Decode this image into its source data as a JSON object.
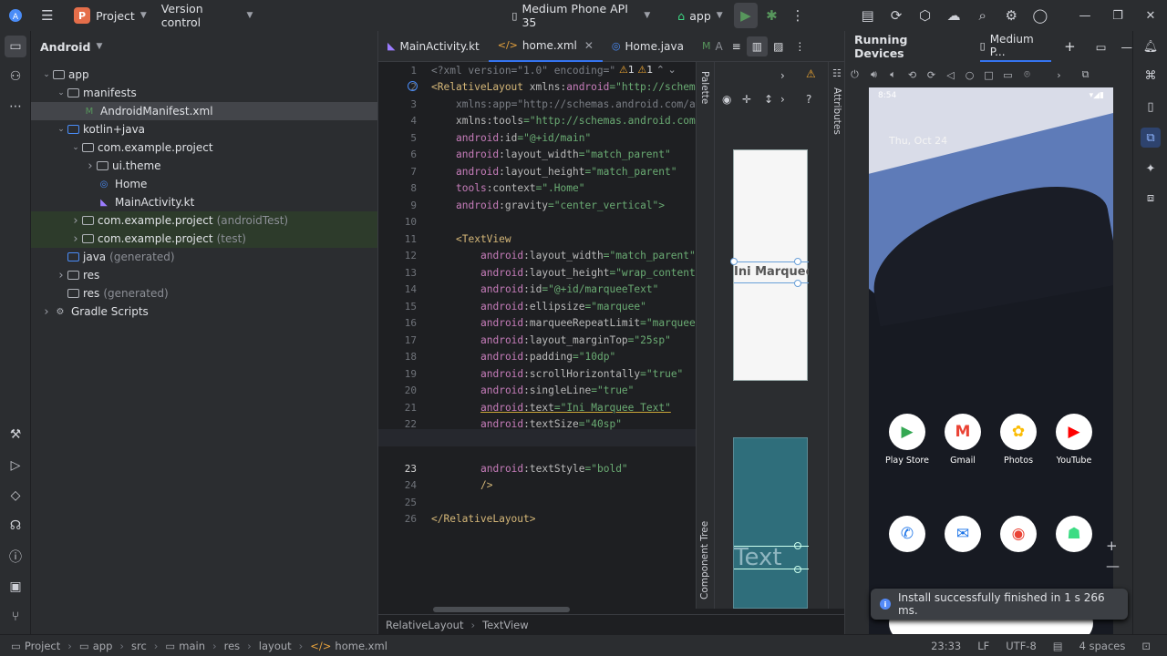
{
  "titlebar": {
    "project_badge": "P",
    "project_label": "Project",
    "vcs_label": "Version control",
    "device_label": "Medium Phone API 35",
    "run_config_label": "app"
  },
  "project_panel": {
    "view_label": "Android",
    "tree": [
      {
        "label": "app",
        "suffix": "",
        "depth": 0,
        "expanded": true
      },
      {
        "label": "manifests",
        "suffix": "",
        "depth": 1,
        "expanded": true
      },
      {
        "label": "AndroidManifest.xml",
        "suffix": "",
        "depth": 2,
        "selected": true
      },
      {
        "label": "kotlin+java",
        "suffix": "",
        "depth": 1,
        "expanded": true
      },
      {
        "label": "com.example.project",
        "suffix": "",
        "depth": 2,
        "expanded": true
      },
      {
        "label": "ui.theme",
        "suffix": "",
        "depth": 3,
        "expanded": false
      },
      {
        "label": "Home",
        "suffix": "",
        "depth": 3
      },
      {
        "label": "MainActivity.kt",
        "suffix": "",
        "depth": 3
      },
      {
        "label": "com.example.project",
        "suffix": "(androidTest)",
        "depth": 2,
        "expanded": false
      },
      {
        "label": "com.example.project",
        "suffix": "(test)",
        "depth": 2,
        "expanded": false
      },
      {
        "label": "java",
        "suffix": "(generated)",
        "depth": 1
      },
      {
        "label": "res",
        "suffix": "",
        "depth": 1,
        "expanded": false
      },
      {
        "label": "res",
        "suffix": "(generated)",
        "depth": 1
      },
      {
        "label": "Gradle Scripts",
        "suffix": "",
        "depth": 0,
        "expanded": false
      }
    ]
  },
  "editor": {
    "tabs": [
      {
        "label": "MainActivity.kt",
        "icon": "K"
      },
      {
        "label": "home.xml",
        "icon": "</>",
        "active": true
      },
      {
        "label": "Home.java",
        "icon": "C"
      },
      {
        "label": "A",
        "icon": "M"
      }
    ],
    "warning_count": "1",
    "warning_count2": "1",
    "line_numbers": [
      "1",
      "2",
      "3",
      "4",
      "5",
      "6",
      "7",
      "8",
      "9",
      "10",
      "11",
      "12",
      "13",
      "14",
      "15",
      "16",
      "17",
      "18",
      "19",
      "20",
      "21",
      "22",
      "23",
      "24",
      "25",
      "26"
    ],
    "code": {
      "l1": "<?xml version=\"1.0\" encoding=\"",
      "l2_tag": "<RelativeLayout",
      "l2_ns": "xmlns:",
      "l2_attr": "android",
      "l2_val": "=\"http://schem",
      "l3": "xmlns:app=\"http://schemas.android.com/a",
      "l4_attr": "xmlns:tools",
      "l4_val": "=\"http://schemas.android.com",
      "l5_ns": "android",
      "l5_attr": ":id",
      "l5_val": "=\"@+id/main\"",
      "l6_attr": ":layout_width",
      "l6_val": "=\"match_parent\"",
      "l7_attr": ":layout_height",
      "l7_val": "=\"match_parent\"",
      "l8_ns": "tools",
      "l8_attr": ":context",
      "l8_val": "=\".Home\"",
      "l9_attr": ":gravity",
      "l9_val": "=\"center_vertical\">",
      "l11": "<TextView",
      "l12_attr": ":layout_width",
      "l12_val": "=\"match_parent\"",
      "l13_attr": ":layout_height",
      "l13_val": "=\"wrap_content",
      "l14_attr": ":id",
      "l14_val": "=\"@+id/marqueeText\"",
      "l15_attr": ":ellipsize",
      "l15_val": "=\"marquee\"",
      "l16_attr": ":marqueeRepeatLimit",
      "l16_val": "=\"marquee",
      "l17_attr": ":layout_marginTop",
      "l17_val": "=\"25sp\"",
      "l18_attr": ":padding",
      "l18_val": "=\"10dp\"",
      "l19_attr": ":scrollHorizontally",
      "l19_val": "=\"true\"",
      "l20_attr": ":singleLine",
      "l20_val": "=\"true\"",
      "l21_attr": ":text",
      "l21_val": "=\"Ini Marquee Text\"",
      "l22_attr": ":textSize",
      "l22_val": "=\"40sp\"",
      "l23_attr": ":textStyle",
      "l23_val": "=\"bold\"",
      "l24": "/>",
      "l26": "</RelativeLayout>"
    },
    "palette_label": "Palette",
    "attributes_label": "Attributes",
    "component_tree_label": "Component Tree",
    "preview_small_text": "Ini Marquee",
    "preview_big_text": "Text",
    "breadcrumb": [
      "RelativeLayout",
      "TextView"
    ]
  },
  "running_devices": {
    "title": "Running Devices",
    "device_tab": "Medium P...",
    "time": "8:54",
    "date": "Thu, Oct 24",
    "apps_row1": [
      {
        "label": "Play Store",
        "glyph": "▶",
        "color": "#34a853"
      },
      {
        "label": "Gmail",
        "glyph": "M",
        "color": "#ea4335"
      },
      {
        "label": "Photos",
        "glyph": "✿",
        "color": "#fbbc04"
      },
      {
        "label": "YouTube",
        "glyph": "▶",
        "color": "#ff0000"
      }
    ],
    "apps_row2": [
      {
        "label": "",
        "glyph": "✆",
        "color": "#1a73e8"
      },
      {
        "label": "",
        "glyph": "✉",
        "color": "#1a73e8"
      },
      {
        "label": "",
        "glyph": "◉",
        "color": "#ea4335"
      },
      {
        "label": "",
        "glyph": "☗",
        "color": "#3ddc84"
      }
    ],
    "toast": "Install successfully finished in 1 s 266 ms."
  },
  "statusbar": {
    "breadcrumb": [
      "Project",
      "app",
      "src",
      "main",
      "res",
      "layout",
      "home.xml"
    ],
    "position": "23:33",
    "line_sep": "LF",
    "encoding": "UTF-8",
    "indent": "4 spaces"
  }
}
